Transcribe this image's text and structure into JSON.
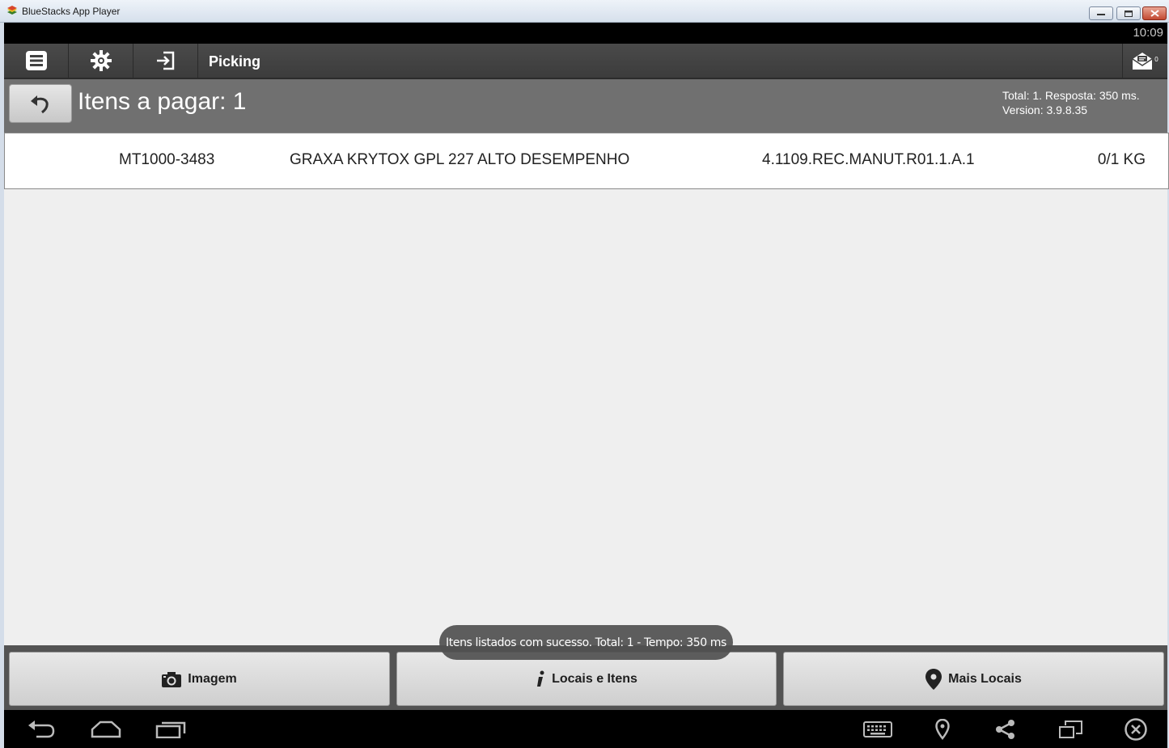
{
  "window": {
    "title": "BlueStacks App Player"
  },
  "status_bar": {
    "clock": "10:09"
  },
  "action_bar": {
    "title": "Picking",
    "message_count": "0",
    "icons": [
      "list-icon",
      "gear-icon",
      "login-icon",
      "message-icon"
    ]
  },
  "header": {
    "title": "Itens a pagar: 1",
    "info_line1": "Total: 1. Resposta: 350 ms.",
    "info_line2": "Version: 3.9.8.35"
  },
  "list": {
    "rows": [
      {
        "code": "MT1000-3483",
        "description": "GRAXA KRYTOX GPL 227 ALTO DESEMPENHO",
        "location": "4.1109.REC.MANUT.R01.1.A.1",
        "quantity": "0/1 KG"
      }
    ]
  },
  "toast": {
    "message": "Itens listados com sucesso. Total: 1 - Tempo: 350 ms"
  },
  "bottom_buttons": {
    "image_label": "Imagem",
    "locais_label": "Locais e Itens",
    "mais_label": "Mais Locais"
  },
  "colors": {
    "action_bar": "#404040",
    "header": "#707070",
    "content_bg": "#efefef"
  }
}
